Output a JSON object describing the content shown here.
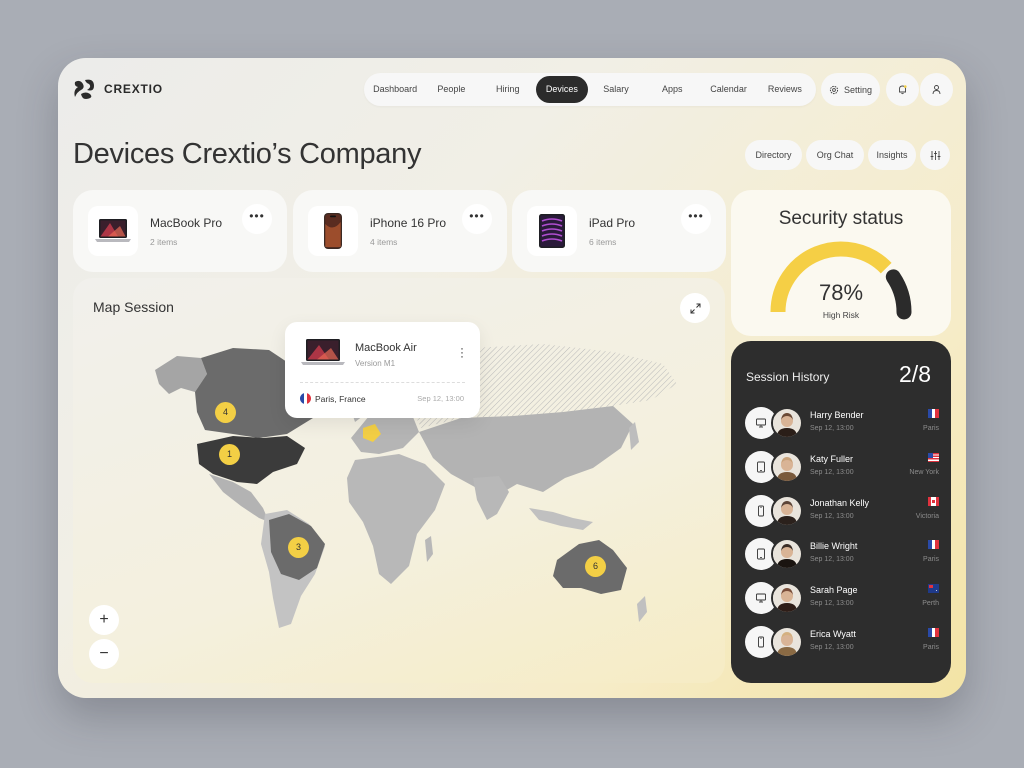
{
  "brand": {
    "name": "CREXTIO"
  },
  "nav": {
    "items": [
      {
        "label": "Dashboard",
        "active": false
      },
      {
        "label": "People",
        "active": false
      },
      {
        "label": "Hiring",
        "active": false
      },
      {
        "label": "Devices",
        "active": true
      },
      {
        "label": "Salary",
        "active": false
      },
      {
        "label": "Apps",
        "active": false
      },
      {
        "label": "Calendar",
        "active": false
      },
      {
        "label": "Reviews",
        "active": false
      }
    ],
    "setting_label": "Setting"
  },
  "page": {
    "title": "Devices Crextio’s Company",
    "actions": [
      "Directory",
      "Org Chat",
      "Insights"
    ]
  },
  "devices": [
    {
      "name": "MacBook Pro",
      "count": "2 items",
      "icon": "laptop-icon"
    },
    {
      "name": "iPhone 16 Pro",
      "count": "4 items",
      "icon": "phone-icon"
    },
    {
      "name": "iPad Pro",
      "count": "6 items",
      "icon": "tablet-icon"
    }
  ],
  "security": {
    "title": "Security status",
    "value": "78%",
    "percent": 78,
    "label": "High Risk",
    "colors": {
      "fill": "#f5cf45",
      "risk": "#2b2b2b"
    }
  },
  "map": {
    "title": "Map Session",
    "popup": {
      "name": "MacBook Air",
      "version": "Version M1",
      "location": "Paris, France",
      "time": "Sep 12, 13:00"
    },
    "markers": [
      {
        "label": "4",
        "region": "Canada"
      },
      {
        "label": "1",
        "region": "USA"
      },
      {
        "label": "3",
        "region": "Brazil"
      },
      {
        "label": "6",
        "region": "Australia"
      }
    ],
    "zoom_in": "+",
    "zoom_out": "−"
  },
  "session_history": {
    "title": "Session History",
    "count": "2/8",
    "rows": [
      {
        "name": "Harry Bender",
        "time": "Sep 12, 13:00",
        "city": "Paris",
        "flag": "france",
        "device": "monitor-icon"
      },
      {
        "name": "Katy Fuller",
        "time": "Sep 12, 13:00",
        "city": "New York",
        "flag": "usa",
        "device": "tablet-icon"
      },
      {
        "name": "Jonathan Kelly",
        "time": "Sep 12, 13:00",
        "city": "Victoria",
        "flag": "canada",
        "device": "phone-icon"
      },
      {
        "name": "Billie Wright",
        "time": "Sep 12, 13:00",
        "city": "Paris",
        "flag": "france",
        "device": "tablet-icon"
      },
      {
        "name": "Sarah Page",
        "time": "Sep 12, 13:00",
        "city": "Perth",
        "flag": "australia",
        "device": "monitor-icon"
      },
      {
        "name": "Erica Wyatt",
        "time": "Sep 12, 13:00",
        "city": "Paris",
        "flag": "france",
        "device": "phone-icon"
      }
    ]
  }
}
